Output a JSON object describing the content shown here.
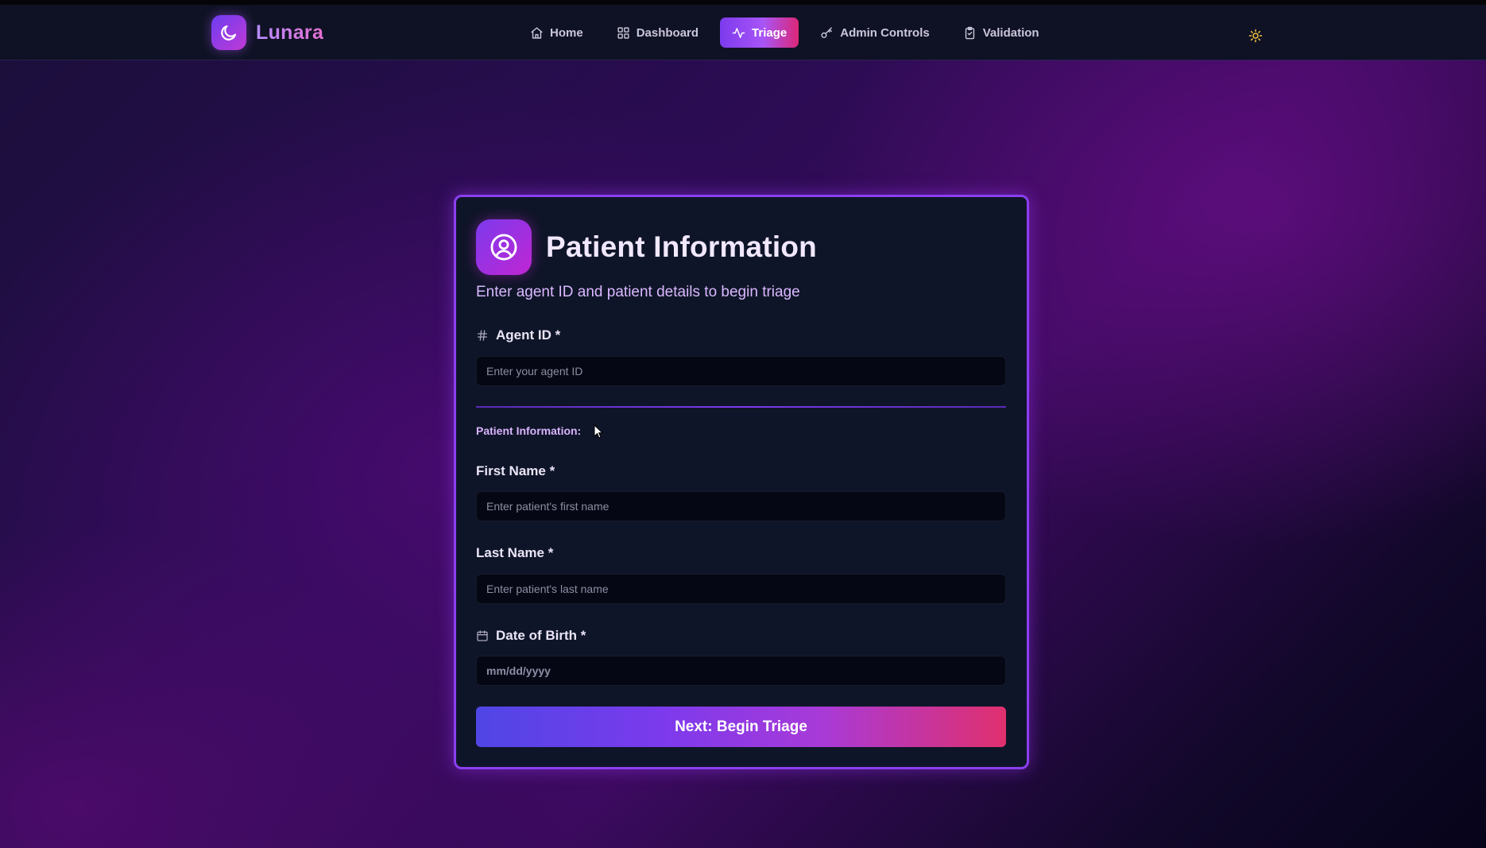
{
  "brand": {
    "name": "Lunara"
  },
  "nav": {
    "items": [
      {
        "label": "Home",
        "icon": "home-icon",
        "active": false
      },
      {
        "label": "Dashboard",
        "icon": "dashboard-icon",
        "active": false
      },
      {
        "label": "Triage",
        "icon": "activity-icon",
        "active": true
      },
      {
        "label": "Admin Controls",
        "icon": "key-icon",
        "active": false
      },
      {
        "label": "Validation",
        "icon": "clipboard-check-icon",
        "active": false
      }
    ],
    "theme_toggle_icon": "sun-icon"
  },
  "card": {
    "title": "Patient Information",
    "subtitle": "Enter agent ID and patient details to begin triage",
    "agent_id": {
      "label": "Agent ID *",
      "placeholder": "Enter your agent ID",
      "value": ""
    },
    "section_label": "Patient Information:",
    "first_name": {
      "label": "First Name *",
      "placeholder": "Enter patient's first name",
      "value": ""
    },
    "last_name": {
      "label": "Last Name *",
      "placeholder": "Enter patient's last name",
      "value": ""
    },
    "dob": {
      "label": "Date of Birth *",
      "placeholder": "mm/dd/yyyy",
      "value": ""
    },
    "submit_label": "Next: Begin Triage"
  },
  "colors": {
    "accent_purple": "#8b3ff0",
    "accent_pink": "#e0306e",
    "card_bg": "#0f1528",
    "navbar_bg": "#0f1224"
  }
}
